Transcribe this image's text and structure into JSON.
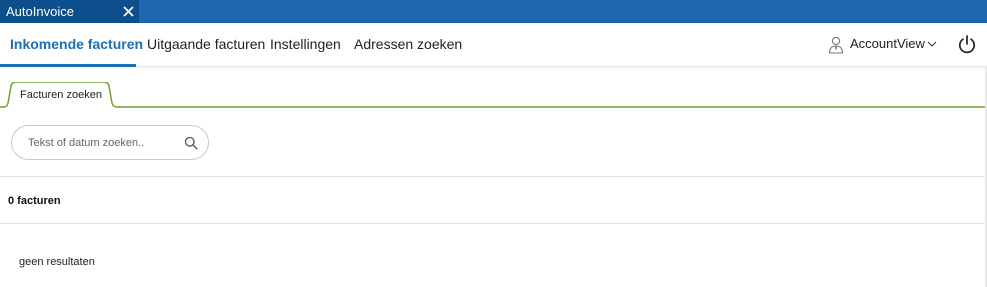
{
  "window": {
    "tab_title": "AutoInvoice"
  },
  "nav": {
    "items": [
      {
        "label": "Inkomende facturen",
        "active": true
      },
      {
        "label": "Uitgaande facturen",
        "active": false
      },
      {
        "label": "Instellingen",
        "active": false
      },
      {
        "label": "Adressen zoeken",
        "active": false
      }
    ],
    "account_name": "AccountView",
    "accent_color": "#1a6fb5"
  },
  "tabs": {
    "items": [
      {
        "label": "Facturen zoeken",
        "active": true
      }
    ],
    "accent_color": "#6aa229"
  },
  "search": {
    "placeholder": "Tekst of datum zoeken..",
    "value": ""
  },
  "results": {
    "count_label": "0 facturen",
    "empty_label": "geen resultaten"
  },
  "colors": {
    "titlebar": "#1d67ae",
    "titlebar_tab": "#0d4f8c"
  }
}
